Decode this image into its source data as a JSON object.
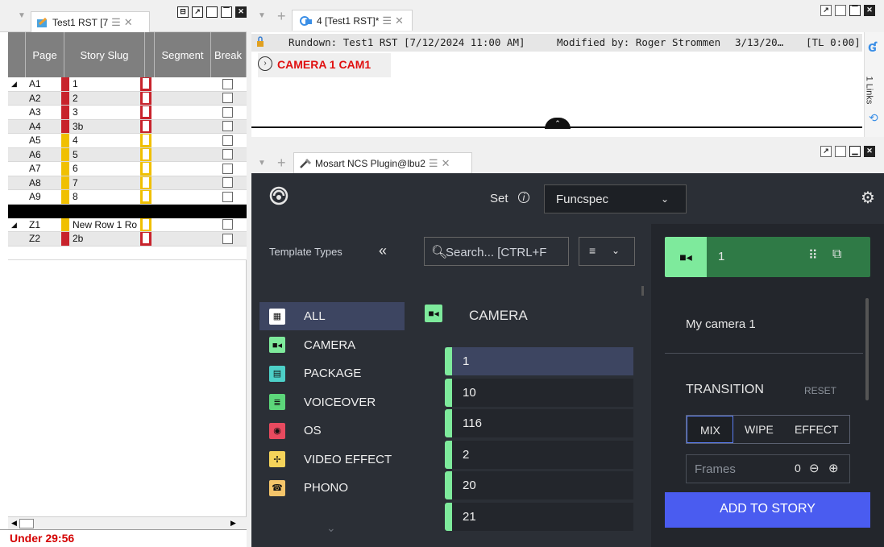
{
  "colors": {
    "red": "#c8232c",
    "yellow": "#f0c000",
    "accent_green": "#7eea9c",
    "accent_blue": "#4a5cf0",
    "dark_bg": "#2b2f36",
    "selected": "#3d4561"
  },
  "left_panel": {
    "tab_title": "Test1 RST [7",
    "columns": [
      "Page",
      "Story Slug",
      "Segment",
      "Break"
    ],
    "rows": [
      {
        "page": "A1",
        "slug": "1",
        "color": "red",
        "arrow": "◢"
      },
      {
        "page": "A2",
        "slug": "2",
        "color": "red",
        "arrow": ""
      },
      {
        "page": "A3",
        "slug": "3",
        "color": "red",
        "arrow": ""
      },
      {
        "page": "A4",
        "slug": "3b",
        "color": "red",
        "arrow": ""
      },
      {
        "page": "A5",
        "slug": "4",
        "color": "yellow",
        "arrow": ""
      },
      {
        "page": "A6",
        "slug": "5",
        "color": "yellow",
        "arrow": ""
      },
      {
        "page": "A7",
        "slug": "6",
        "color": "yellow",
        "arrow": ""
      },
      {
        "page": "A8",
        "slug": "7",
        "color": "yellow",
        "arrow": ""
      },
      {
        "page": "A9",
        "slug": "8",
        "color": "yellow",
        "arrow": ""
      }
    ],
    "rows2": [
      {
        "page": "Z1",
        "slug": "New Row 1 Ro",
        "color": "yellow",
        "arrow": "◢"
      },
      {
        "page": "Z2",
        "slug": "2b",
        "color": "red",
        "arrow": ""
      }
    ],
    "status": "Under 29:56"
  },
  "rundown": {
    "tab_title": "4 [Test1 RST]*",
    "rundown_label": "Rundown: Test1 RST [7/12/2024 11:00 AM]",
    "modified_by": "Modified by: Roger Strommen",
    "modified_date": "3/13/20…",
    "tl": "[TL 0:00]",
    "item": "CAMERA 1 CAM1",
    "side_label": "1 Links"
  },
  "plugin": {
    "tab_title": "Mosart NCS Plugin@lbu2",
    "set_label": "Set",
    "set_value": "Funcspec",
    "template_types_label": "Template Types",
    "search_placeholder": "Search... [CTRL+F",
    "types": [
      {
        "label": "ALL",
        "icon": "grid-icon",
        "color": "#ffffff"
      },
      {
        "label": "CAMERA",
        "icon": "camera-icon",
        "color": "#7eea9c"
      },
      {
        "label": "PACKAGE",
        "icon": "film-icon",
        "color": "#4dd0c8"
      },
      {
        "label": "VOICEOVER",
        "icon": "voiceover-icon",
        "color": "#5cd67a"
      },
      {
        "label": "OS",
        "icon": "record-icon",
        "color": "#e84a5f"
      },
      {
        "label": "VIDEO EFFECT",
        "icon": "effect-icon",
        "color": "#f5d35a"
      },
      {
        "label": "PHONO",
        "icon": "phone-icon",
        "color": "#f5c56a"
      }
    ],
    "group_title": "CAMERA",
    "templates": [
      "1",
      "10",
      "116",
      "2",
      "20",
      "21"
    ],
    "detail": {
      "number": "1",
      "name": "My camera 1",
      "transition_label": "TRANSITION",
      "reset_label": "RESET",
      "transitions": [
        "MIX",
        "WIPE",
        "EFFECT"
      ],
      "frames_label": "Frames",
      "frames_value": "0",
      "add_label": "ADD TO STORY"
    }
  }
}
